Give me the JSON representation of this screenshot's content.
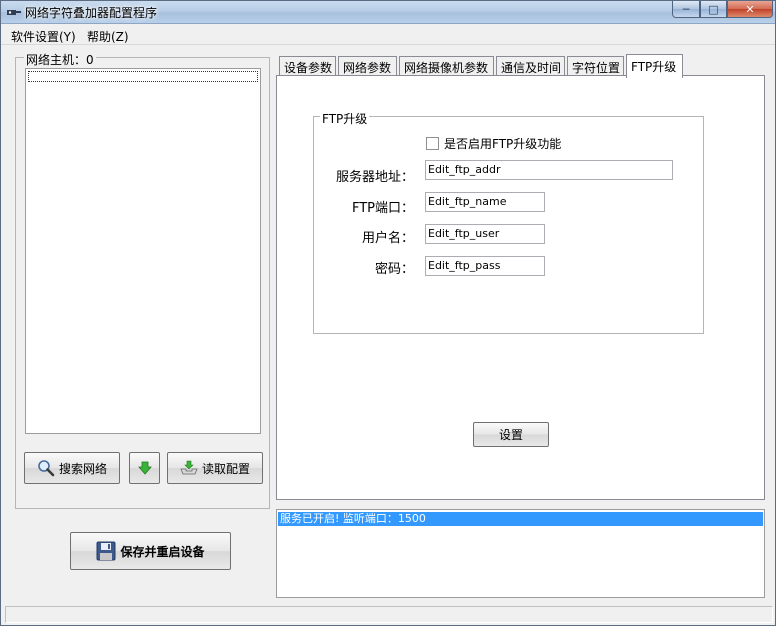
{
  "window": {
    "title": "网络字符叠加器配置程序"
  },
  "menu": {
    "items": [
      {
        "label": "软件设置(Y)"
      },
      {
        "label": "帮助(Z)"
      }
    ]
  },
  "host_panel": {
    "title": "网络主机：0",
    "search_button": "搜索网络",
    "read_button": "读取配置",
    "save_button": "保存并重启设备"
  },
  "tabs": [
    {
      "label": "设备参数",
      "active": false
    },
    {
      "label": "网络参数",
      "active": false
    },
    {
      "label": "网络摄像机参数",
      "active": false
    },
    {
      "label": "通信及时间",
      "active": false
    },
    {
      "label": "字符位置",
      "active": false
    },
    {
      "label": "FTP升级",
      "active": true
    }
  ],
  "ftp": {
    "group_title": "FTP升级",
    "enable_label": "是否启用FTP升级功能",
    "enable_checked": false,
    "server_label": "服务器地址：",
    "server_value": "Edit_ftp_addr",
    "port_label": "FTP端口：",
    "port_value": "Edit_ftp_name",
    "user_label": "用户名：",
    "user_value": "Edit_ftp_user",
    "pass_label": "密码：",
    "pass_value": "Edit_ftp_pass",
    "set_button": "设置"
  },
  "log": {
    "entries": [
      "服务已开启! 监听端口：1500"
    ]
  },
  "colors": {
    "selection": "#3399ff",
    "window_bg": "#f0f0f0"
  }
}
